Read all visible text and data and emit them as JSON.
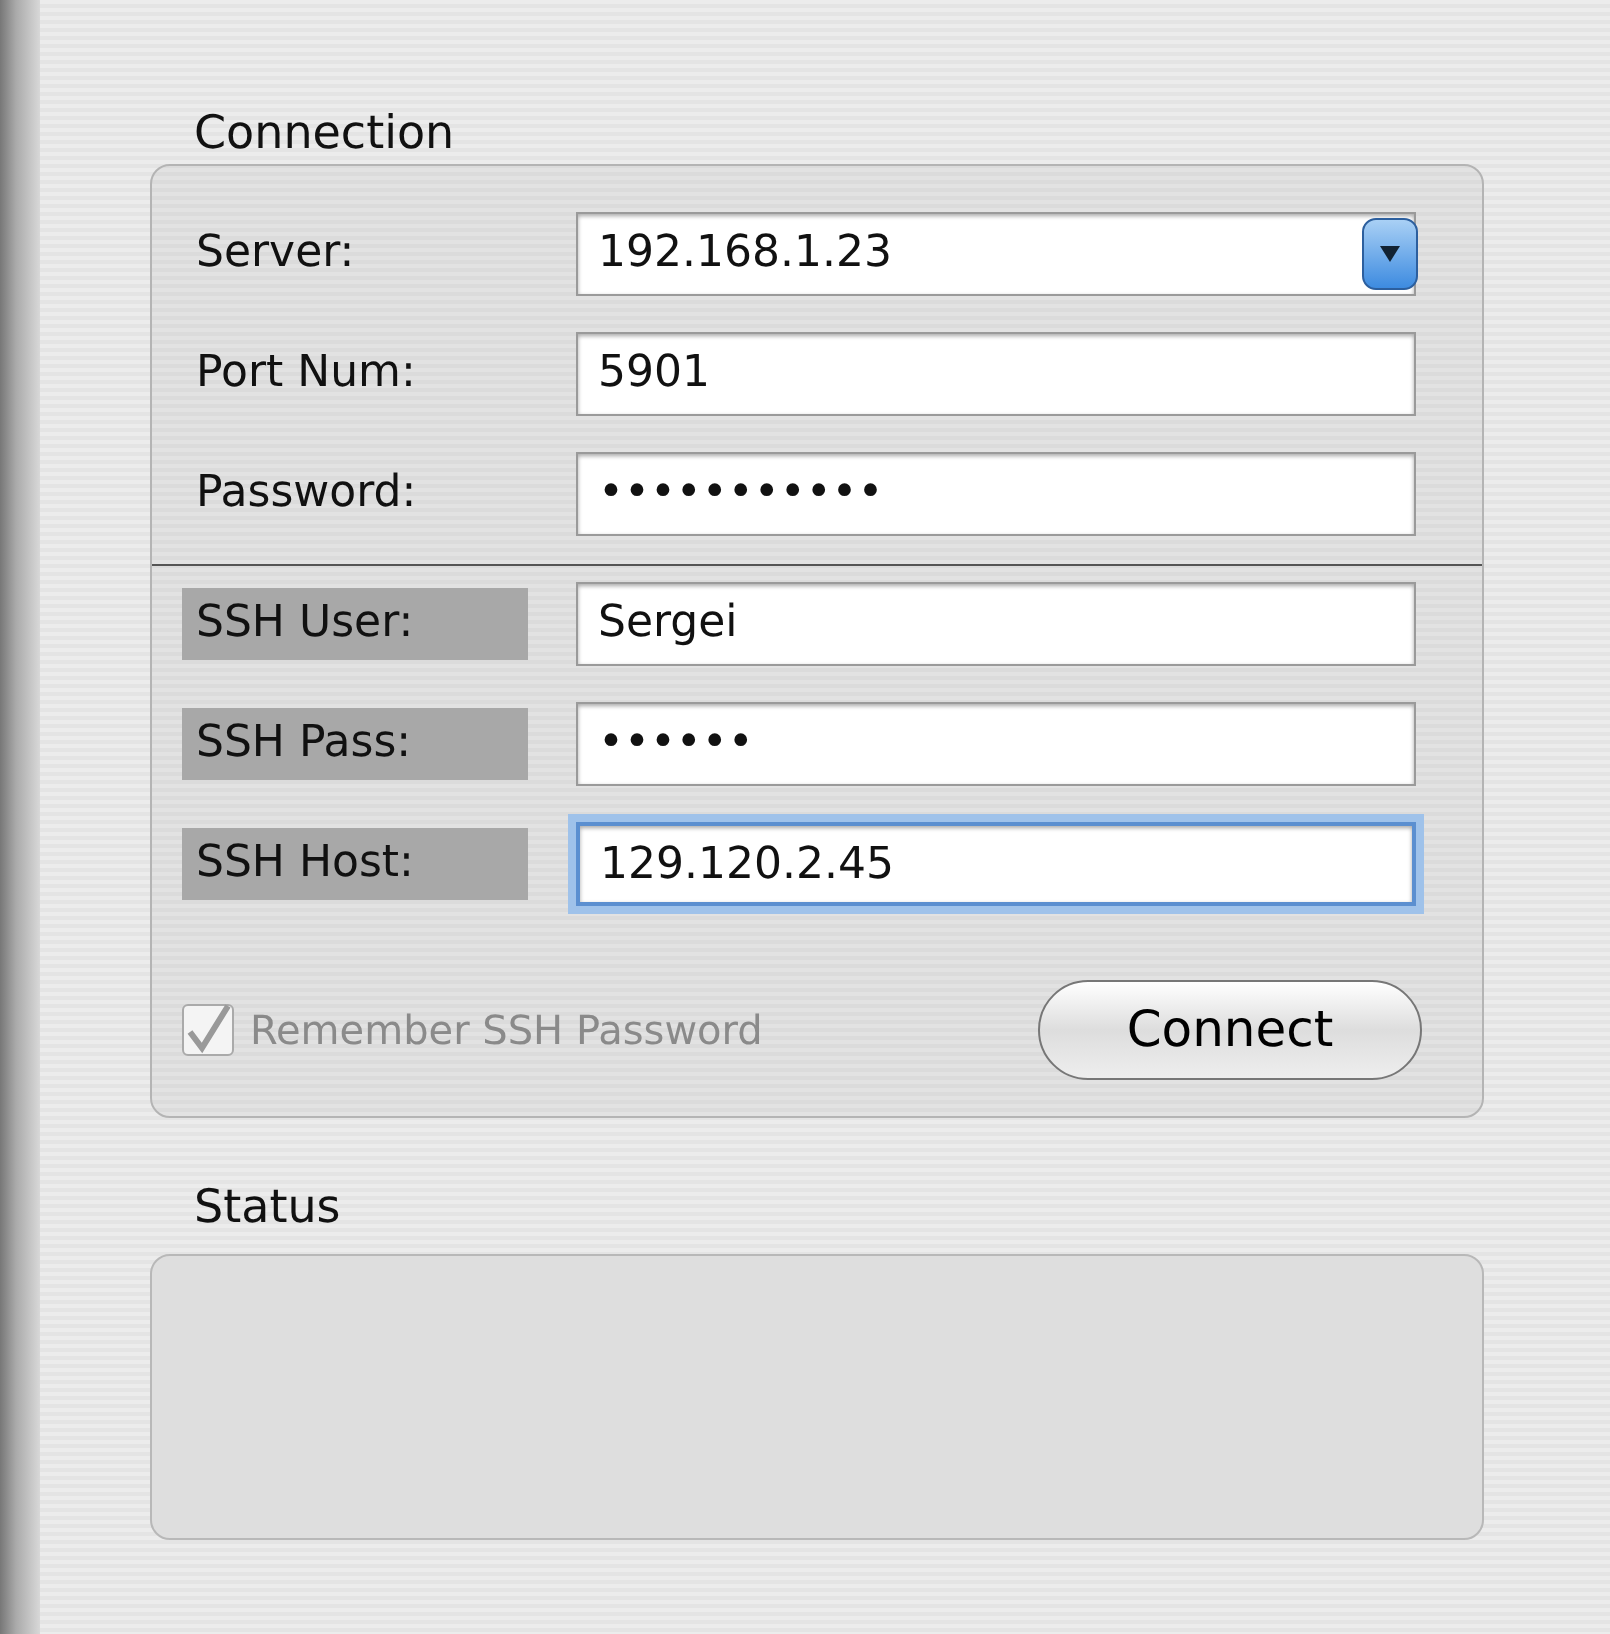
{
  "connection": {
    "title": "Connection",
    "fields": [
      {
        "kind": "combo",
        "label": "Server:",
        "value": "192.168.1.23",
        "focused": false
      },
      {
        "kind": "text",
        "label": "Port Num:",
        "value": "5901",
        "focused": false
      },
      {
        "kind": "text",
        "label": "Password:",
        "value": "•••••••••••",
        "focused": false
      }
    ],
    "ssh_fields": [
      {
        "label": "SSH User:",
        "value": "Sergei",
        "focused": false
      },
      {
        "label": "SSH Pass:",
        "value": "••••••",
        "focused": false
      },
      {
        "label": "SSH Host:",
        "value": "129.120.2.45",
        "focused": true
      }
    ],
    "remember": {
      "label": "Remember SSH Password",
      "checked": true,
      "disabled": true
    },
    "button": "Connect"
  },
  "status": {
    "title": "Status"
  }
}
